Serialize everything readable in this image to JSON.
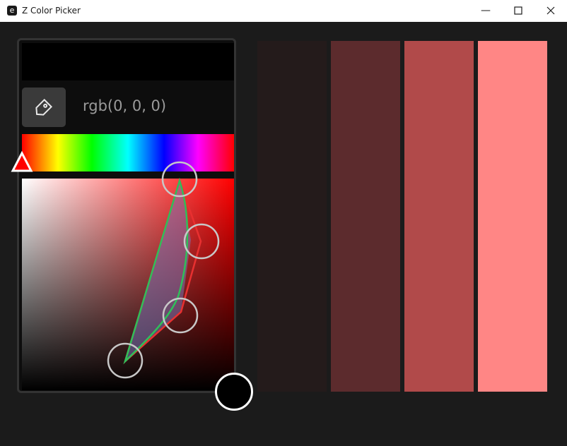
{
  "window": {
    "title": "Z Color Picker",
    "app_icon_glyph": "e",
    "minimize_glyph": "—",
    "maximize_glyph": "☐",
    "close_glyph": "✕"
  },
  "picker": {
    "preview_color": "#000000",
    "rgb_text": "rgb(0, 0, 0)",
    "copy_icon": "tag-icon",
    "hue_marker_color": "#ff0000"
  },
  "swatches": [
    {
      "color": "#241b1b"
    },
    {
      "color": "#5c2b2d"
    },
    {
      "color": "#b14a4a"
    },
    {
      "color": "#ff8685"
    }
  ],
  "add_color_button": {
    "color": "#000000"
  }
}
